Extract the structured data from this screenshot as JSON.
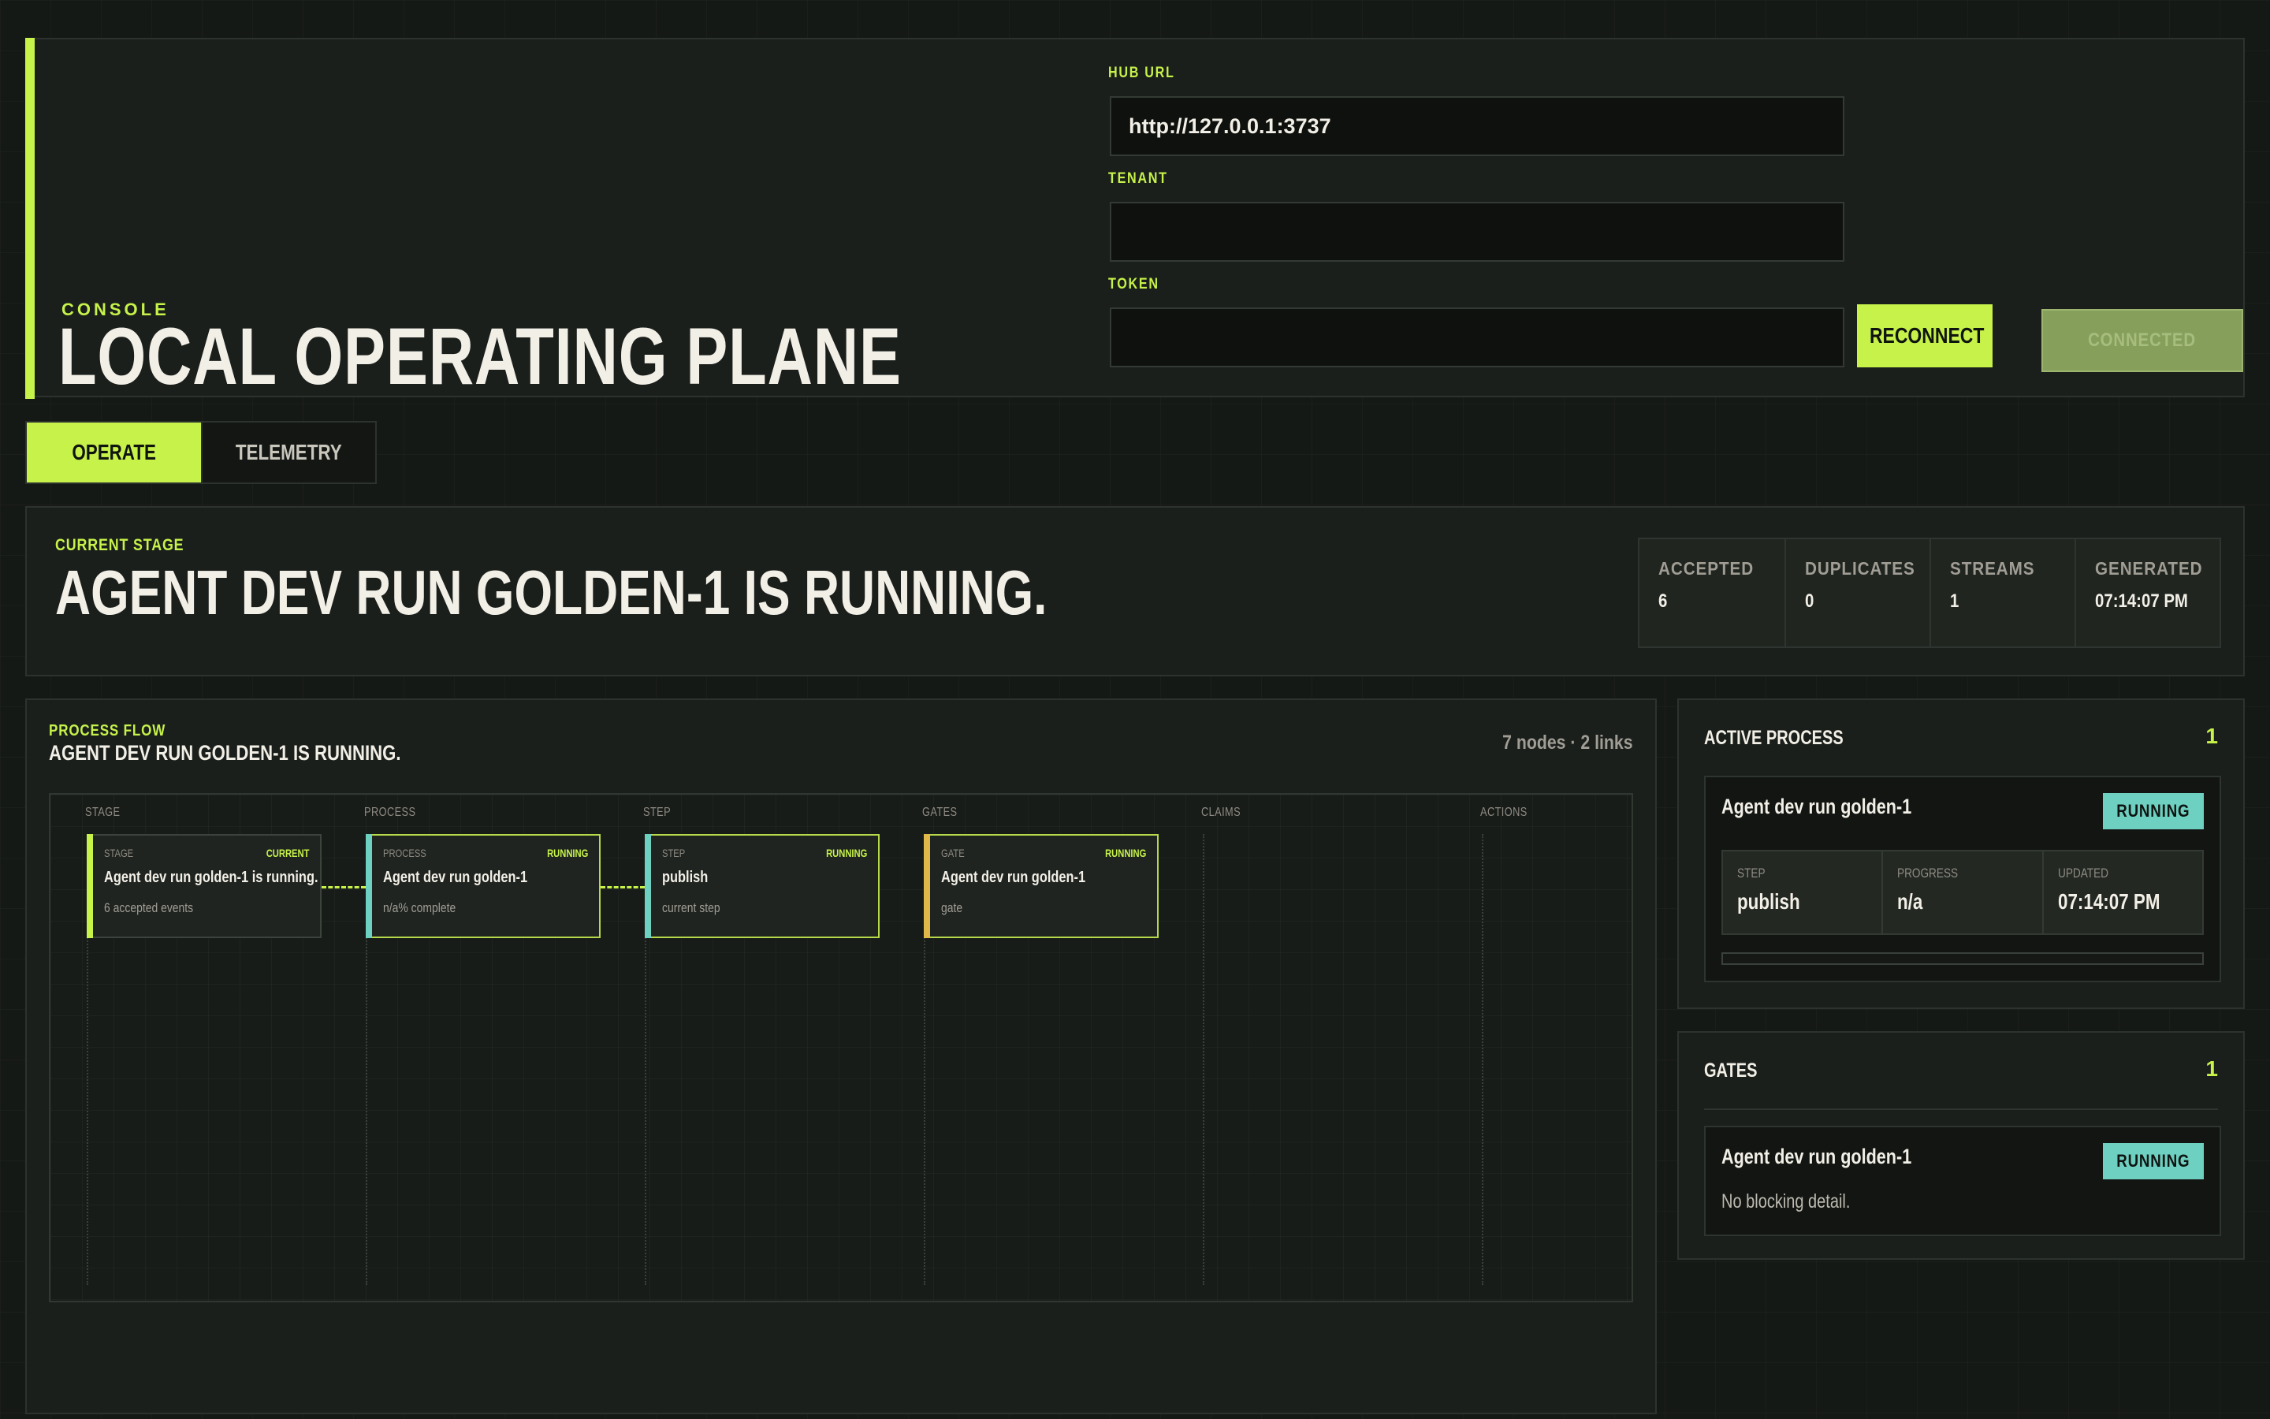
{
  "header": {
    "eyebrow": "CONSOLE",
    "title": "LOCAL OPERATING PLANE",
    "hub_url_label": "HUB URL",
    "hub_url_value": "http://127.0.0.1:3737",
    "tenant_label": "TENANT",
    "tenant_value": "",
    "token_label": "TOKEN",
    "token_value": "",
    "reconnect_label": "RECONNECT",
    "connected_label": "CONNECTED"
  },
  "tabs": [
    {
      "label": "OPERATE",
      "active": true
    },
    {
      "label": "TELEMETRY",
      "active": false
    }
  ],
  "stage": {
    "eyebrow": "CURRENT STAGE",
    "title": "AGENT DEV RUN GOLDEN-1 IS RUNNING.",
    "stats": [
      {
        "label": "ACCEPTED",
        "value": "6"
      },
      {
        "label": "DUPLICATES",
        "value": "0"
      },
      {
        "label": "STREAMS",
        "value": "1"
      },
      {
        "label": "GENERATED",
        "value": "07:14:07 PM"
      }
    ]
  },
  "flow": {
    "eyebrow": "PROCESS FLOW",
    "title": "AGENT DEV RUN GOLDEN-1 IS RUNNING.",
    "summary": "7 nodes · 2 links",
    "lanes": [
      "STAGE",
      "PROCESS",
      "STEP",
      "GATES",
      "CLAIMS",
      "ACTIONS"
    ],
    "nodes": [
      {
        "kind": "STAGE",
        "status": "CURRENT",
        "title": "Agent dev run golden-1 is running.",
        "sub": "6 accepted events",
        "bar_color": "#c6f24a",
        "border_color": "#3c433d"
      },
      {
        "kind": "PROCESS",
        "status": "RUNNING",
        "title": "Agent dev run golden-1",
        "sub": "n/a% complete",
        "bar_color": "#6ed0c0",
        "border_color": "#b6d94a"
      },
      {
        "kind": "STEP",
        "status": "RUNNING",
        "title": "publish",
        "sub": "current step",
        "bar_color": "#6ed0c0",
        "border_color": "#b6d94a"
      },
      {
        "kind": "GATE",
        "status": "RUNNING",
        "title": "Agent dev run golden-1",
        "sub": "gate",
        "bar_color": "#e0b84a",
        "border_color": "#b6d94a"
      }
    ]
  },
  "active_process": {
    "title": "ACTIVE PROCESS",
    "count": "1",
    "card_title": "Agent dev run golden-1",
    "status": "RUNNING",
    "metrics": [
      {
        "label": "STEP",
        "value": "publish"
      },
      {
        "label": "PROGRESS",
        "value": "n/a"
      },
      {
        "label": "UPDATED",
        "value": "07:14:07 PM"
      }
    ],
    "progress_fraction": 0
  },
  "gates": {
    "title": "GATES",
    "count": "1",
    "card_title": "Agent dev run golden-1",
    "status": "RUNNING",
    "detail": "No blocking detail."
  },
  "colors": {
    "accent": "#c6f24a",
    "running": "#6ed0c0",
    "gate": "#e0b84a"
  }
}
